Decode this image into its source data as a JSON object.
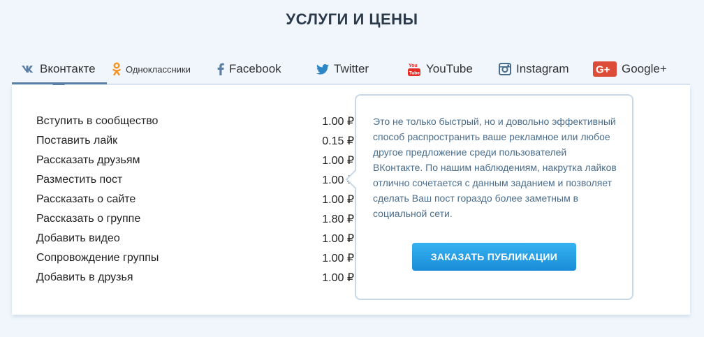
{
  "page": {
    "title": "УСЛУГИ И ЦЕНЫ"
  },
  "tabs": [
    {
      "label": "Вконтакте",
      "icon": "vk-icon",
      "active": true
    },
    {
      "label": "Одноклассники",
      "icon": "odnoklassniki-icon",
      "active": false
    },
    {
      "label": "Facebook",
      "icon": "facebook-icon",
      "active": false
    },
    {
      "label": "Twitter",
      "icon": "twitter-icon",
      "active": false
    },
    {
      "label": "YouTube",
      "icon": "youtube-icon",
      "active": false
    },
    {
      "label": "Instagram",
      "icon": "instagram-icon",
      "active": false
    },
    {
      "label": "Google+",
      "icon": "google-plus-icon",
      "active": false
    }
  ],
  "prices": [
    {
      "service": "Вступить в сообщество",
      "price": "1.00 ₽"
    },
    {
      "service": "Поставить лайк",
      "price": "0.15 ₽"
    },
    {
      "service": "Рассказать друзьям",
      "price": "1.00 ₽"
    },
    {
      "service": "Разместить пост",
      "price": "1.00 ₽"
    },
    {
      "service": "Рассказать о сайте",
      "price": "1.00 ₽"
    },
    {
      "service": "Рассказать о группе",
      "price": "1.80 ₽"
    },
    {
      "service": "Добавить видео",
      "price": "1.00 ₽"
    },
    {
      "service": "Сопровождение группы",
      "price": "1.00 ₽"
    },
    {
      "service": "Добавить в друзья",
      "price": "1.00 ₽"
    }
  ],
  "info": {
    "text": "Это не только быстрый, но и довольно эффективный способ распространить ваше рекламное или любое другое предложение среди пользователей ВКонтакте. По нашим наблюдениям, накрутка лайков отлично сочетается с данным заданием и позволяет сделать Ваш пост гораздо более заметным в социальной сети.",
    "button_label": "ЗАКАЗАТЬ ПУБЛИКАЦИИ"
  },
  "colors": {
    "accent": "#5b7fa4",
    "button": "#1a8cd8",
    "info_text": "#4a6d8c",
    "odnoklassniki": "#f7931e",
    "youtube": "#e52d27",
    "google_plus": "#dd4b39"
  }
}
